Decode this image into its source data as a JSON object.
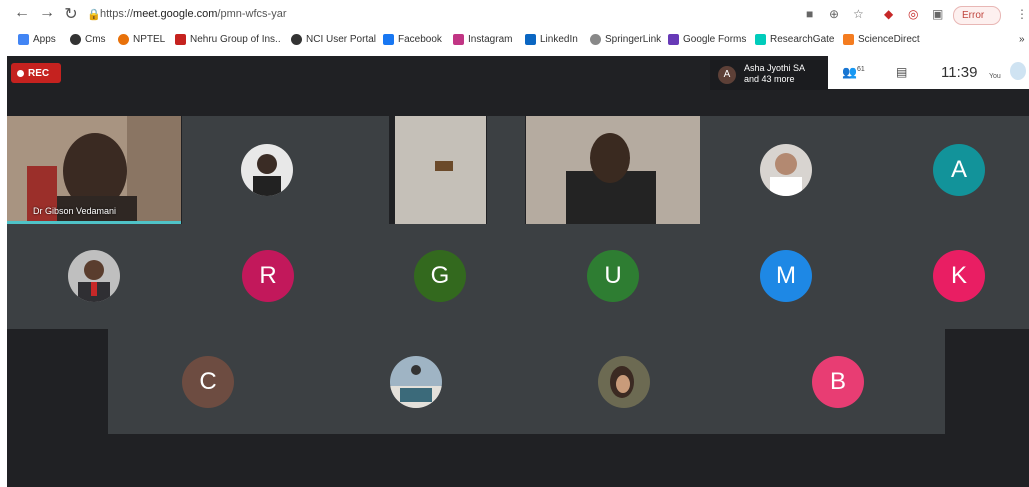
{
  "browser": {
    "url_scheme": "https://",
    "url_host": "meet.google.com",
    "url_path": "/pmn-wfcs-yar",
    "error_label": "Error"
  },
  "bookmarks": [
    {
      "label": "Apps",
      "color": "#4285f4"
    },
    {
      "label": "Cms",
      "color": "#333333"
    },
    {
      "label": "NPTEL",
      "color": "#e8710a"
    },
    {
      "label": "Nehru Group of Ins..",
      "color": "#c5221f"
    },
    {
      "label": "NCI User Portal",
      "color": "#333333"
    },
    {
      "label": "Facebook",
      "color": "#1877f2"
    },
    {
      "label": "Instagram",
      "color": "#c13584"
    },
    {
      "label": "LinkedIn",
      "color": "#0a66c2"
    },
    {
      "label": "SpringerLink",
      "color": "#555555"
    },
    {
      "label": "Google Forms",
      "color": "#673ab7"
    },
    {
      "label": "ResearchGate",
      "color": "#00ccbb"
    },
    {
      "label": "ScienceDirect",
      "color": "#f47c20"
    }
  ],
  "meet": {
    "rec_label": "REC",
    "presenter_initial": "A",
    "presenter_name": "Asha Jyothi SA",
    "presenter_more": "and 43 more",
    "participants_count": "61",
    "time": "11:39",
    "you_label": "You",
    "speaker_name": "Dr Gibson Vedamani"
  },
  "tiles": [
    {
      "initial": "A",
      "color": "#12939a"
    },
    {
      "initial": "R",
      "color": "#c2185b"
    },
    {
      "initial": "G",
      "color": "#33691e"
    },
    {
      "initial": "U",
      "color": "#2e7d32"
    },
    {
      "initial": "M",
      "color": "#1e88e5"
    },
    {
      "initial": "K",
      "color": "#e91e63"
    },
    {
      "initial": "C",
      "color": "#6d4c41"
    },
    {
      "initial": "B",
      "color": "#e83d73"
    }
  ]
}
